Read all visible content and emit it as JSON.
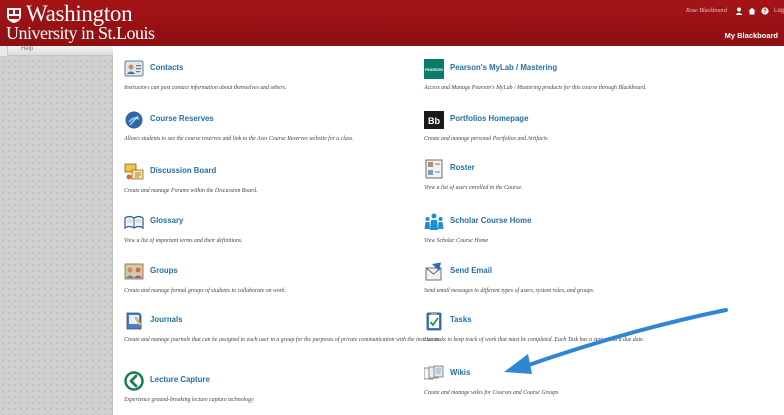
{
  "header": {
    "logo_line1": "Washington",
    "logo_line2": "University in St.Louis",
    "username": "Rose Blackboard",
    "logout_label": "Log",
    "tab_label": "My Blackboard"
  },
  "sidebar": {
    "help_label": "Help"
  },
  "tools": {
    "contacts": {
      "title": "Contacts",
      "desc": "Instructors can post contact information about themselves and others."
    },
    "pearson": {
      "title": "Pearson's MyLab / Mastering",
      "desc": "Access and Manage Pearson's MyLab / Mastering products for this course through Blackboard.",
      "badge": "PEARSON"
    },
    "course_reserves": {
      "title": "Course Reserves",
      "desc": "Allows students to see the course reserves and link to the Ares Course Reserves website for a class."
    },
    "portfolios": {
      "title": "Portfolios Homepage",
      "desc": "Create and manage personal Portfolios and Artifacts.",
      "badge": "Bb"
    },
    "discussion_board": {
      "title": "Discussion Board",
      "desc": "Create and manage Forums within the Discussion Board."
    },
    "roster": {
      "title": "Roster",
      "desc": "View a list of users enrolled in the Course."
    },
    "glossary": {
      "title": "Glossary",
      "desc": "View a list of important terms and their definitions."
    },
    "scholar": {
      "title": "Scholar Course Home",
      "desc": "View Scholar Course Home"
    },
    "groups": {
      "title": "Groups",
      "desc": "Create and manage formal groups of students to collaborate on work."
    },
    "send_email": {
      "title": "Send Email",
      "desc": "Send email messages to different types of users, system roles, and groups."
    },
    "journals": {
      "title": "Journals",
      "desc": "Create and manage journals that can be assigned to each user in a group for the purposes of private communication with the instructor."
    },
    "tasks": {
      "title": "Tasks",
      "desc": "Use tasks to keep track of work that must be completed. Each Task has a status and a due date."
    },
    "lecture_capture": {
      "title": "Lecture Capture",
      "desc": "Experience ground-breaking lecture capture technology"
    },
    "wikis": {
      "title": "Wikis",
      "desc": "Create and manage wikis for Courses and Course Groups"
    }
  },
  "colors": {
    "header_red": "#a51417",
    "link_blue": "#2570a3",
    "arrow_blue": "#2f86d4"
  }
}
